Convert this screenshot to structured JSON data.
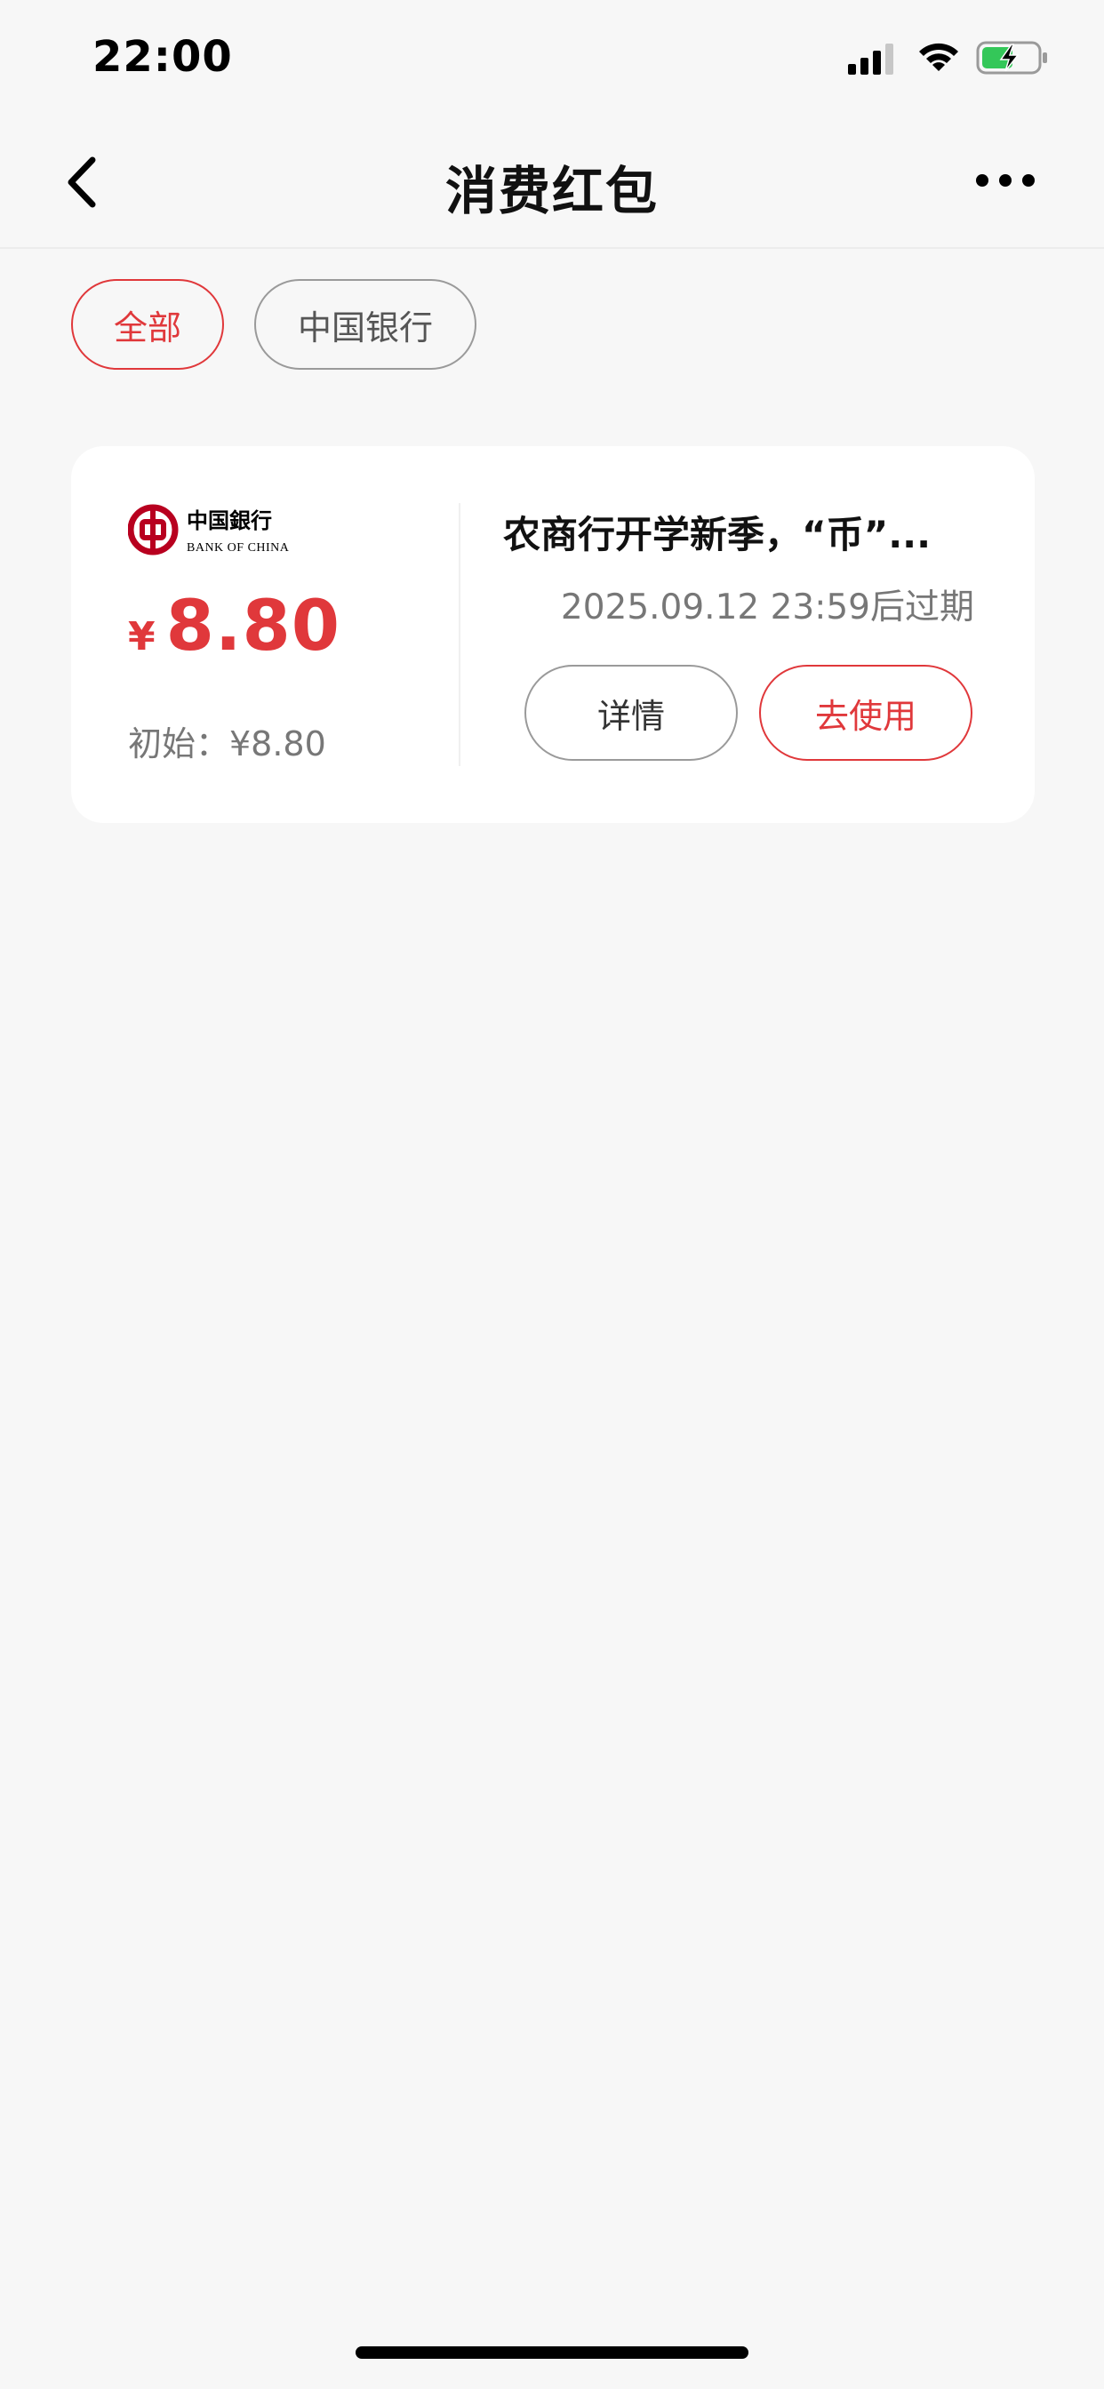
{
  "status_bar": {
    "time": "22:00",
    "icons": [
      "signal-icon",
      "wifi-icon",
      "battery-charging-icon"
    ]
  },
  "nav": {
    "title": "消费红包",
    "back_icon": "chevron-left-icon",
    "more_icon": "more-dots-icon"
  },
  "filters": [
    {
      "label": "全部",
      "active": true
    },
    {
      "label": "中国银行",
      "active": false
    }
  ],
  "coupon": {
    "bank_logo_text_cn": "中国银行",
    "bank_logo_text_en": "BANK OF CHINA",
    "currency_symbol": "¥",
    "amount": "8.80",
    "initial_label": "初始：¥8.80",
    "title": "农商行开学新季，“币”...",
    "expire_text": "2025.09.12 23:59后过期",
    "detail_button": "详情",
    "use_button": "去使用"
  },
  "colors": {
    "accent": "#e0383b",
    "background": "#f7f7f7",
    "card": "#ffffff",
    "logo_red": "#b8001f"
  }
}
